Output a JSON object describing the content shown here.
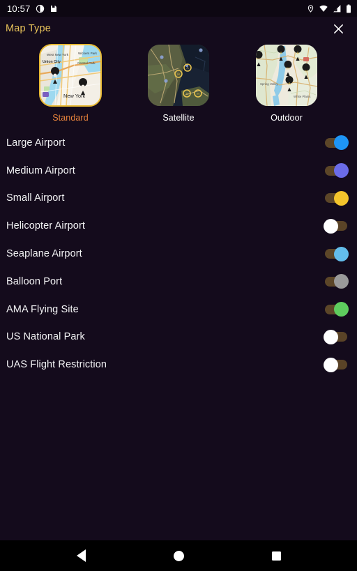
{
  "status_bar": {
    "time": "10:57",
    "left_icons": [
      "contrast-icon",
      "save-icon"
    ],
    "right_icons": [
      "location-pin-icon",
      "wifi-icon",
      "cellular-signal-icon",
      "battery-icon"
    ]
  },
  "header": {
    "title": "Map Type",
    "close_label": "✕"
  },
  "map_types": [
    {
      "id": "standard",
      "label": "Standard",
      "selected": true
    },
    {
      "id": "satellite",
      "label": "Satellite",
      "selected": false
    },
    {
      "id": "outdoor",
      "label": "Outdoor",
      "selected": false
    }
  ],
  "layers": [
    {
      "label": "Large Airport",
      "on": true,
      "color": "#1e95f5"
    },
    {
      "label": "Medium Airport",
      "on": true,
      "color": "#6b6ce8"
    },
    {
      "label": "Small Airport",
      "on": true,
      "color": "#f5c52c"
    },
    {
      "label": "Helicopter Airport",
      "on": false,
      "color": "#ffffff"
    },
    {
      "label": "Seaplane Airport",
      "on": true,
      "color": "#63bdeb"
    },
    {
      "label": "Balloon Port",
      "on": true,
      "color": "#9a9a9a"
    },
    {
      "label": "AMA Flying Site",
      "on": true,
      "color": "#5ecd5e"
    },
    {
      "label": "US National Park",
      "on": false,
      "color": "#ffffff"
    },
    {
      "label": "UAS Flight Restriction",
      "on": false,
      "color": "#ffffff"
    }
  ],
  "navigation_bar": {
    "back_label": "Back",
    "home_label": "Home",
    "recents_label": "Recents"
  },
  "colors": {
    "background": "#140b1c",
    "status_bar_bg": "#0d0712",
    "title_accent": "#e7c25a",
    "selected_label": "#e8833c",
    "selected_border": "#e8b933",
    "track_on": "#5c4628",
    "track_off": "#5a4327",
    "nav_bg": "#000000"
  }
}
